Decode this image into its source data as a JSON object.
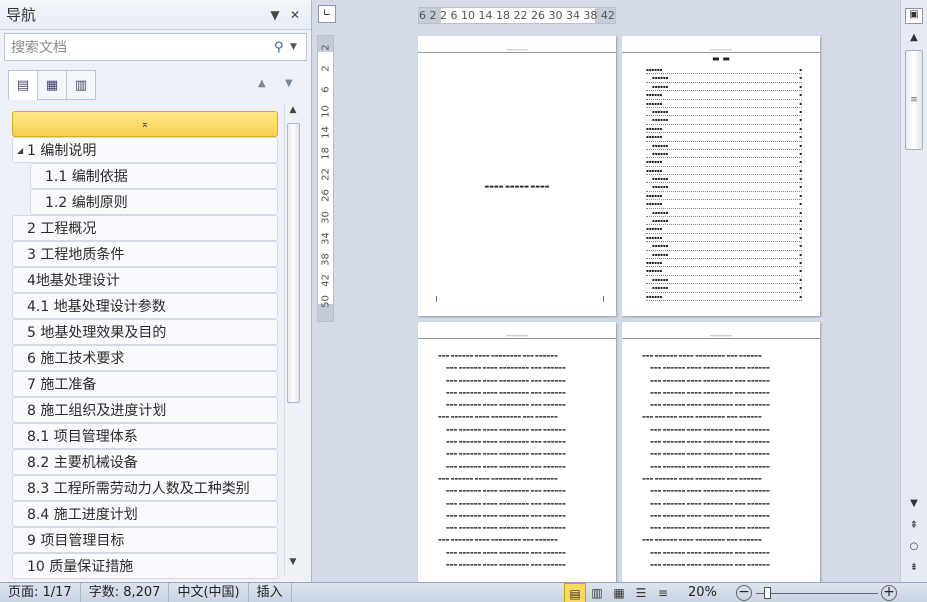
{
  "nav": {
    "title": "导航",
    "dropdown_icon": "▼",
    "close_icon": "✕",
    "search_placeholder": "搜索文档",
    "collapse_glyph": "⌅",
    "items": [
      {
        "label": "1 编制说明",
        "level": 1,
        "expanded": true
      },
      {
        "label": "1.1 编制依据",
        "level": 2
      },
      {
        "label": "1.2 编制原则",
        "level": 2
      },
      {
        "label": "2 工程概况",
        "level": 1
      },
      {
        "label": "3 工程地质条件",
        "level": 1
      },
      {
        "label": "4地基处理设计",
        "level": 1
      },
      {
        "label": "4.1 地基处理设计参数",
        "level": 1
      },
      {
        "label": "5 地基处理效果及目的",
        "level": 1
      },
      {
        "label": "6 施工技术要求",
        "level": 1
      },
      {
        "label": "7 施工准备",
        "level": 1
      },
      {
        "label": "8 施工组织及进度计划",
        "level": 1
      },
      {
        "label": "8.1 项目管理体系",
        "level": 1
      },
      {
        "label": "8.2 主要机械设备",
        "level": 1
      },
      {
        "label": "8.3 工程所需劳动力人数及工种类别",
        "level": 1
      },
      {
        "label": "8.4 施工进度计划",
        "level": 1
      },
      {
        "label": "9 项目管理目标",
        "level": 1
      },
      {
        "label": "10 质量保证措施",
        "level": 1
      }
    ]
  },
  "ruler": {
    "h_ticks": "6 2 2 6 10 14 18 22 26 30 34 38 42 48",
    "v_ticks": [
      "2",
      "2",
      "6",
      "10",
      "14",
      "18",
      "22",
      "26",
      "30",
      "34",
      "38",
      "42",
      "50"
    ]
  },
  "status": {
    "page": "页面: 1/17",
    "words": "字数: 8,207",
    "lang": "中文(中国)",
    "mode": "插入",
    "zoom": "20%"
  }
}
